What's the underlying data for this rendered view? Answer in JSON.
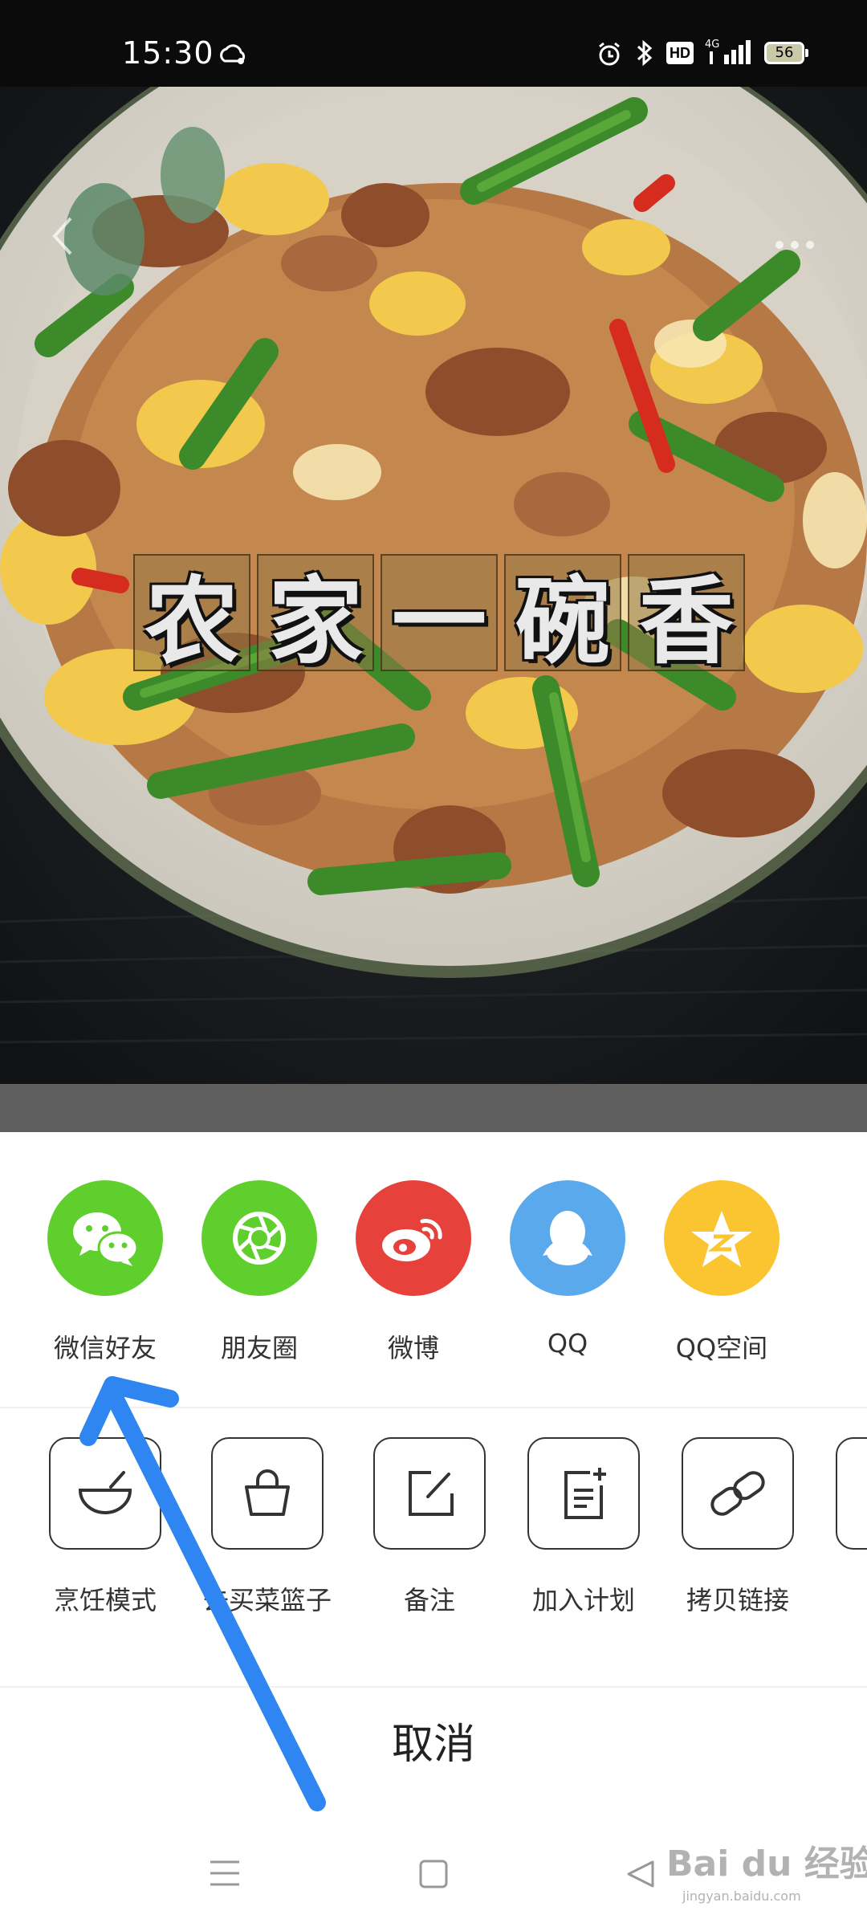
{
  "status_bar": {
    "time": "15:30",
    "hd": "HD",
    "network": "4G",
    "battery": "56",
    "icons": [
      "cloud-sync-icon",
      "alarm-icon",
      "bluetooth-icon",
      "signal-icon",
      "battery-icon"
    ]
  },
  "hero": {
    "title_chars": [
      "农",
      "家",
      "一",
      "碗",
      "香"
    ],
    "back_icon": "back-chevron-icon",
    "more_icon": "more-dots-icon"
  },
  "share_targets": [
    {
      "label": "微信好友",
      "icon": "wechat-icon",
      "color": "#5fcf2d"
    },
    {
      "label": "朋友圈",
      "icon": "moments-icon",
      "color": "#5fcf2d"
    },
    {
      "label": "微博",
      "icon": "weibo-icon",
      "color": "#e6413b"
    },
    {
      "label": "QQ",
      "icon": "qq-icon",
      "color": "#5aa9ec"
    },
    {
      "label": "QQ空间",
      "icon": "qzone-icon",
      "color": "#fbc531"
    }
  ],
  "tools": [
    {
      "label": "烹饪模式",
      "icon": "bowl-icon"
    },
    {
      "label": "去买菜篮子",
      "icon": "basket-icon"
    },
    {
      "label": "备注",
      "icon": "edit-note-icon"
    },
    {
      "label": "加入计划",
      "icon": "add-plan-icon"
    },
    {
      "label": "拷贝链接",
      "icon": "link-icon"
    }
  ],
  "cancel_label": "取消",
  "nav": {
    "icons": [
      "menu-icon",
      "home-icon",
      "back-icon"
    ]
  },
  "watermark": {
    "text": "Bai du 经验",
    "sub": "jingyan.baidu.com"
  },
  "colors": {
    "annotation_arrow": "#2f86f0",
    "sheet_background": "#ffffff"
  }
}
